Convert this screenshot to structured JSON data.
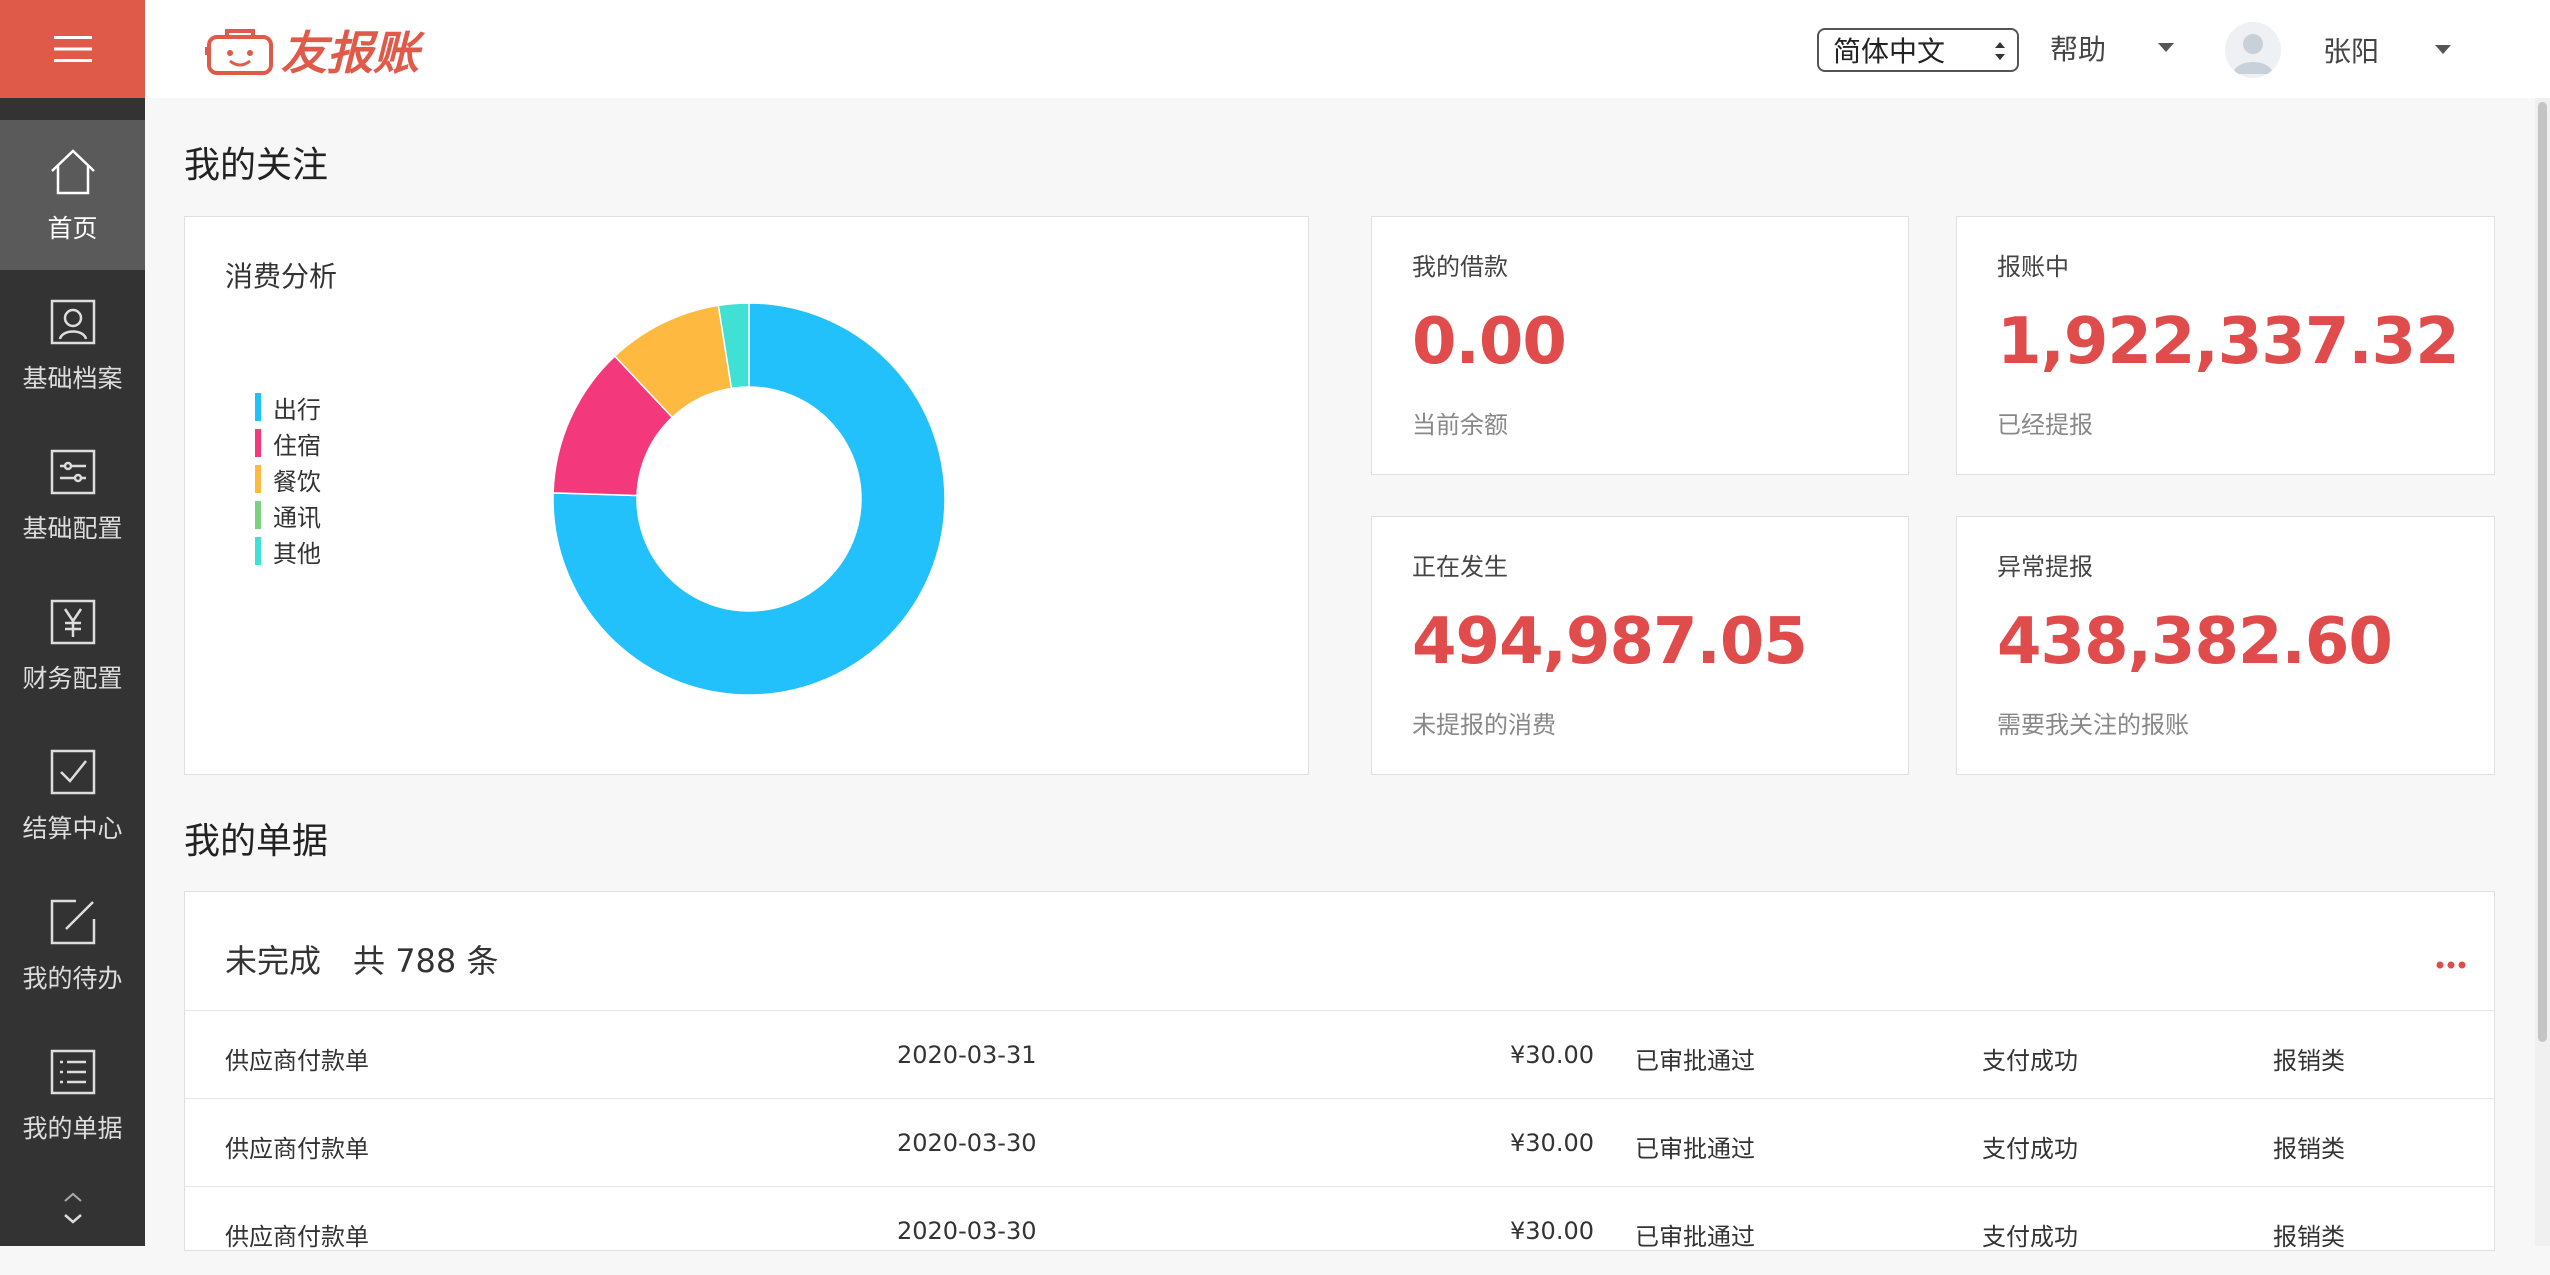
{
  "app": {
    "logo_text": "友报账"
  },
  "header": {
    "language": "简体中文",
    "help": "帮助",
    "user_name": "张阳"
  },
  "sidebar": {
    "items": [
      {
        "label": "首页",
        "icon": "home-icon"
      },
      {
        "label": "基础档案",
        "icon": "profile-icon"
      },
      {
        "label": "基础配置",
        "icon": "sliders-icon"
      },
      {
        "label": "财务配置",
        "icon": "yen-icon"
      },
      {
        "label": "结算中心",
        "icon": "checkbox-icon"
      },
      {
        "label": "我的待办",
        "icon": "edit-icon"
      },
      {
        "label": "我的单据",
        "icon": "list-icon"
      }
    ]
  },
  "focus": {
    "title": "我的关注",
    "chart_title": "消费分析",
    "legend": [
      "出行",
      "住宿",
      "餐饮",
      "通讯",
      "其他"
    ]
  },
  "stats": {
    "loan": {
      "label": "我的借款",
      "value": "0.00",
      "sub": "当前余额"
    },
    "reimbursing": {
      "label": "报账中",
      "value": "1,922,337.32",
      "sub": "已经提报"
    },
    "occurring": {
      "label": "正在发生",
      "value": "494,987.05",
      "sub": "未提报的消费"
    },
    "abnormal": {
      "label": "异常提报",
      "value": "438,382.60",
      "sub": "需要我关注的报账"
    }
  },
  "bills": {
    "title": "我的单据",
    "status": "未完成",
    "count_text": "共 788 条",
    "rows": [
      {
        "name": "供应商付款单",
        "date": "2020-03-31",
        "amount": "¥30.00",
        "approval": "已审批通过",
        "payment": "支付成功",
        "type": "报销类"
      },
      {
        "name": "供应商付款单",
        "date": "2020-03-30",
        "amount": "¥30.00",
        "approval": "已审批通过",
        "payment": "支付成功",
        "type": "报销类"
      },
      {
        "name": "供应商付款单",
        "date": "2020-03-30",
        "amount": "¥30.00",
        "approval": "已审批通过",
        "payment": "支付成功",
        "type": "报销类"
      }
    ]
  },
  "chart_data": {
    "type": "pie",
    "title": "消费分析",
    "categories": [
      "出行",
      "住宿",
      "餐饮",
      "通讯",
      "其他"
    ],
    "values": [
      75.5,
      12.5,
      9.5,
      0,
      2.5
    ],
    "colors": [
      "#22c1fb",
      "#f4387c",
      "#fdb940",
      "#7bd17e",
      "#41e0d4"
    ],
    "legend_position": "left"
  }
}
